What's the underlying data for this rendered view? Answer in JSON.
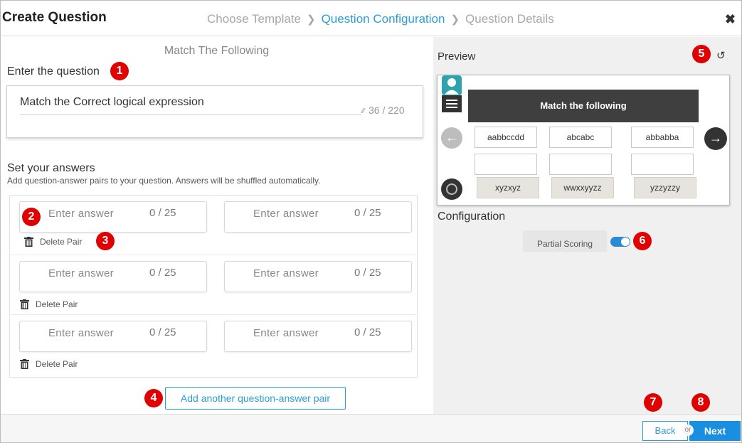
{
  "header": {
    "title": "Create Question",
    "steps": [
      "Choose Template",
      "Question Configuration",
      "Question Details"
    ],
    "active_step": 1,
    "close_glyph": "✖"
  },
  "left": {
    "question_type": "Match The Following",
    "enter_question_label": "Enter the question",
    "question_value": "Match the Correct logical expression",
    "question_count": "36 / 220",
    "answers_label": "Set your answers",
    "answers_hint": "Add question-answer pairs to your question. Answers will be shuffled automatically.",
    "answer_placeholder": "Enter answer",
    "answer_count": "0 / 25",
    "delete_label": "Delete Pair",
    "add_pair_label": "Add another question-answer pair"
  },
  "right": {
    "preview_label": "Preview",
    "reset_icon": "↺",
    "preview_title": "Match the following",
    "top_cells": [
      "aabbccdd",
      "abcabc",
      "abbabba"
    ],
    "bottom_cells": [
      "xyzxyz",
      "wwxxyyzz",
      "yzzyzzy"
    ],
    "configuration_label": "Configuration",
    "partial_scoring_label": "Partial Scoring",
    "partial_scoring_on": true
  },
  "footer": {
    "back_label": "Back",
    "or_label": "or",
    "next_label": "Next"
  },
  "markers": [
    "1",
    "2",
    "3",
    "4",
    "5",
    "6",
    "7",
    "8"
  ],
  "colors": {
    "accent": "#2a9fd6",
    "marker": "#e00000",
    "next_button": "#1a8fe0"
  }
}
